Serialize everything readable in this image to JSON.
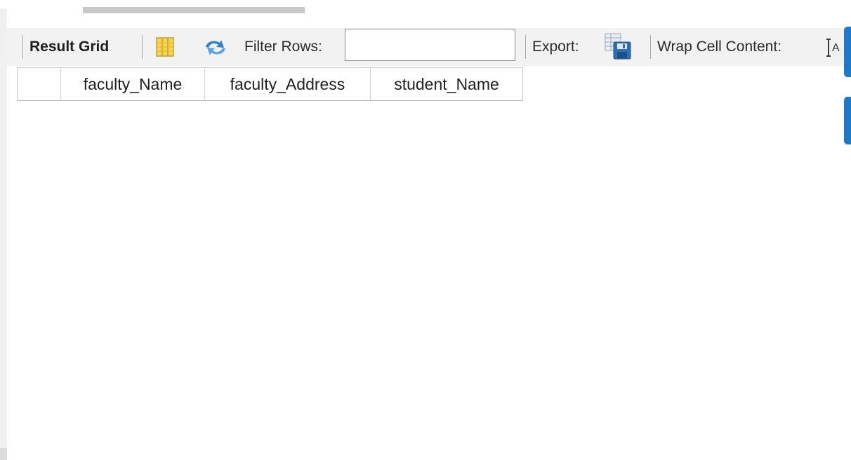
{
  "toolbar": {
    "result_grid_label": "Result Grid",
    "filter_rows_label": "Filter Rows:",
    "filter_rows_value": "",
    "export_label": "Export:",
    "wrap_cell_label": "Wrap Cell Content:"
  },
  "icons": {
    "grid_toggle": "grid-columns-icon",
    "refresh": "refresh-arrows-icon",
    "export": "export-save-icon",
    "wrap": "wrap-cell-icon"
  },
  "grid": {
    "columns": [
      "faculty_Name",
      "faculty_Address",
      "student_Name"
    ],
    "rows": []
  },
  "colors": {
    "accent": "#1f78c8",
    "toolbar_bg": "#f2f2f2",
    "icon_yellow": "#f2c12e",
    "icon_blue": "#2f7fd1"
  }
}
